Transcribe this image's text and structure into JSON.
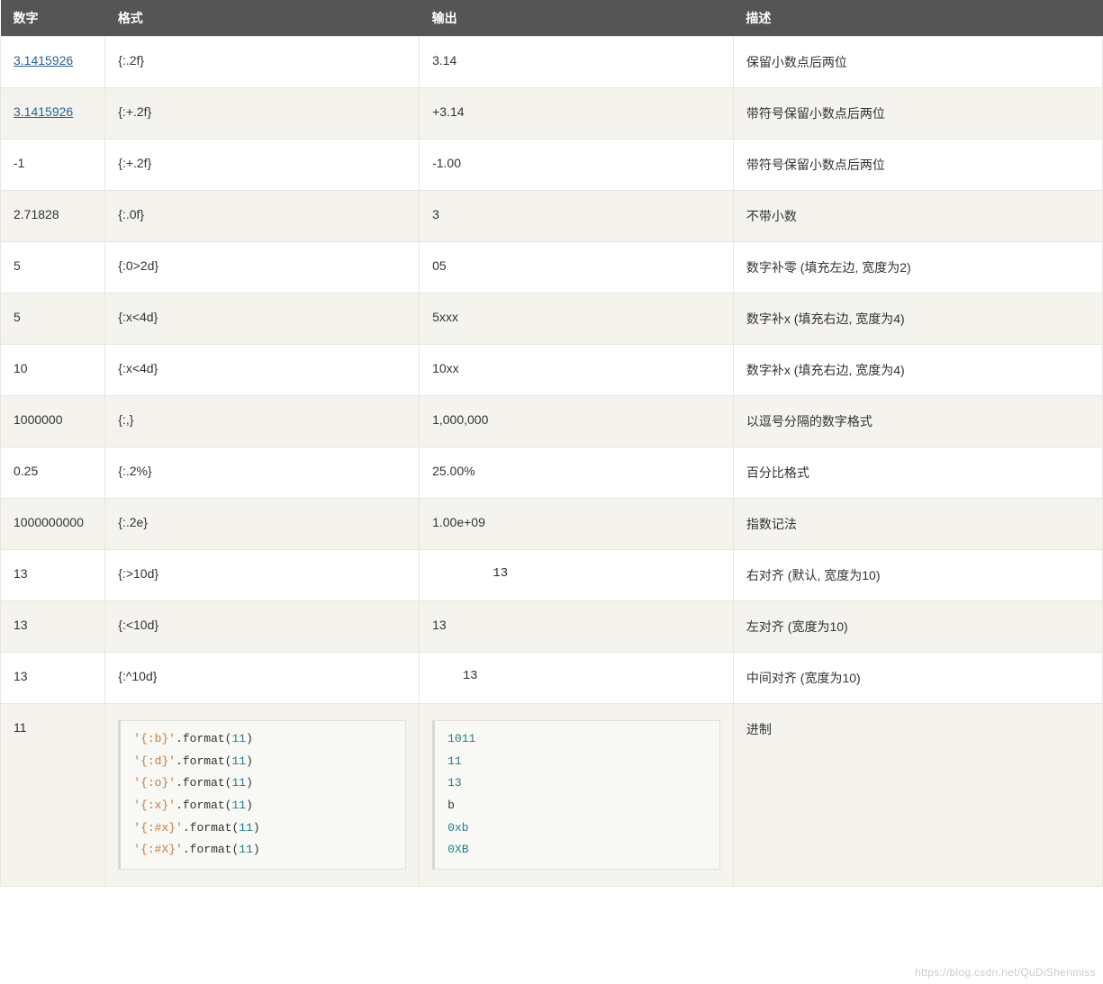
{
  "headers": {
    "number": "数字",
    "format": "格式",
    "output": "输出",
    "description": "描述"
  },
  "rows": [
    {
      "number": "3.1415926",
      "number_is_link": true,
      "format": "{:.2f}",
      "output": "3.14",
      "description": "保留小数点后两位"
    },
    {
      "number": "3.1415926",
      "number_is_link": true,
      "format": "{:+.2f}",
      "output": "+3.14",
      "description": "带符号保留小数点后两位"
    },
    {
      "number": "-1",
      "number_is_link": false,
      "format": "{:+.2f}",
      "output": "-1.00",
      "description": "带符号保留小数点后两位"
    },
    {
      "number": "2.71828",
      "number_is_link": false,
      "format": "{:.0f}",
      "output": "3",
      "description": "不带小数"
    },
    {
      "number": "5",
      "number_is_link": false,
      "format": "{:0>2d}",
      "output": "05",
      "description": "数字补零 (填充左边, 宽度为2)"
    },
    {
      "number": "5",
      "number_is_link": false,
      "format": "{:x<4d}",
      "output": "5xxx",
      "description": "数字补x (填充右边, 宽度为4)"
    },
    {
      "number": "10",
      "number_is_link": false,
      "format": "{:x<4d}",
      "output": "10xx",
      "description": "数字补x (填充右边, 宽度为4)"
    },
    {
      "number": "1000000",
      "number_is_link": false,
      "format": "{:,}",
      "output": "1,000,000",
      "description": "以逗号分隔的数字格式"
    },
    {
      "number": "0.25",
      "number_is_link": false,
      "format": "{:.2%}",
      "output": "25.00%",
      "description": "百分比格式"
    },
    {
      "number": "1000000000",
      "number_is_link": false,
      "format": "{:.2e}",
      "output": "1.00e+09",
      "description": "指数记法"
    },
    {
      "number": "13",
      "number_is_link": false,
      "format": "{:>10d}",
      "output": "        13",
      "description": "右对齐 (默认, 宽度为10)",
      "mono_output": true
    },
    {
      "number": "13",
      "number_is_link": false,
      "format": "{:<10d}",
      "output": "13",
      "description": "左对齐 (宽度为10)"
    },
    {
      "number": "13",
      "number_is_link": false,
      "format": "{:^10d}",
      "output": "    13",
      "description": "中间对齐 (宽度为10)",
      "mono_output": true
    }
  ],
  "code_row": {
    "number": "11",
    "description": "进制",
    "format_code": [
      {
        "str": "'{:b}'",
        "func": ".format(",
        "arg": "11",
        "close": ")"
      },
      {
        "str": "'{:d}'",
        "func": ".format(",
        "arg": "11",
        "close": ")"
      },
      {
        "str": "'{:o}'",
        "func": ".format(",
        "arg": "11",
        "close": ")"
      },
      {
        "str": "'{:x}'",
        "func": ".format(",
        "arg": "11",
        "close": ")"
      },
      {
        "str": "'{:#x}'",
        "func": ".format(",
        "arg": "11",
        "close": ")"
      },
      {
        "str": "'{:#X}'",
        "func": ".format(",
        "arg": "11",
        "close": ")"
      }
    ],
    "output_code": [
      {
        "text": "1011",
        "class": "tok-out"
      },
      {
        "text": "11",
        "class": "tok-out"
      },
      {
        "text": "13",
        "class": "tok-out"
      },
      {
        "text": "b",
        "class": ""
      },
      {
        "text": "0xb",
        "class": "tok-out"
      },
      {
        "text": "0XB",
        "class": "tok-out"
      }
    ]
  },
  "watermark": "https://blog.csdn.net/QuDiShenmiss"
}
